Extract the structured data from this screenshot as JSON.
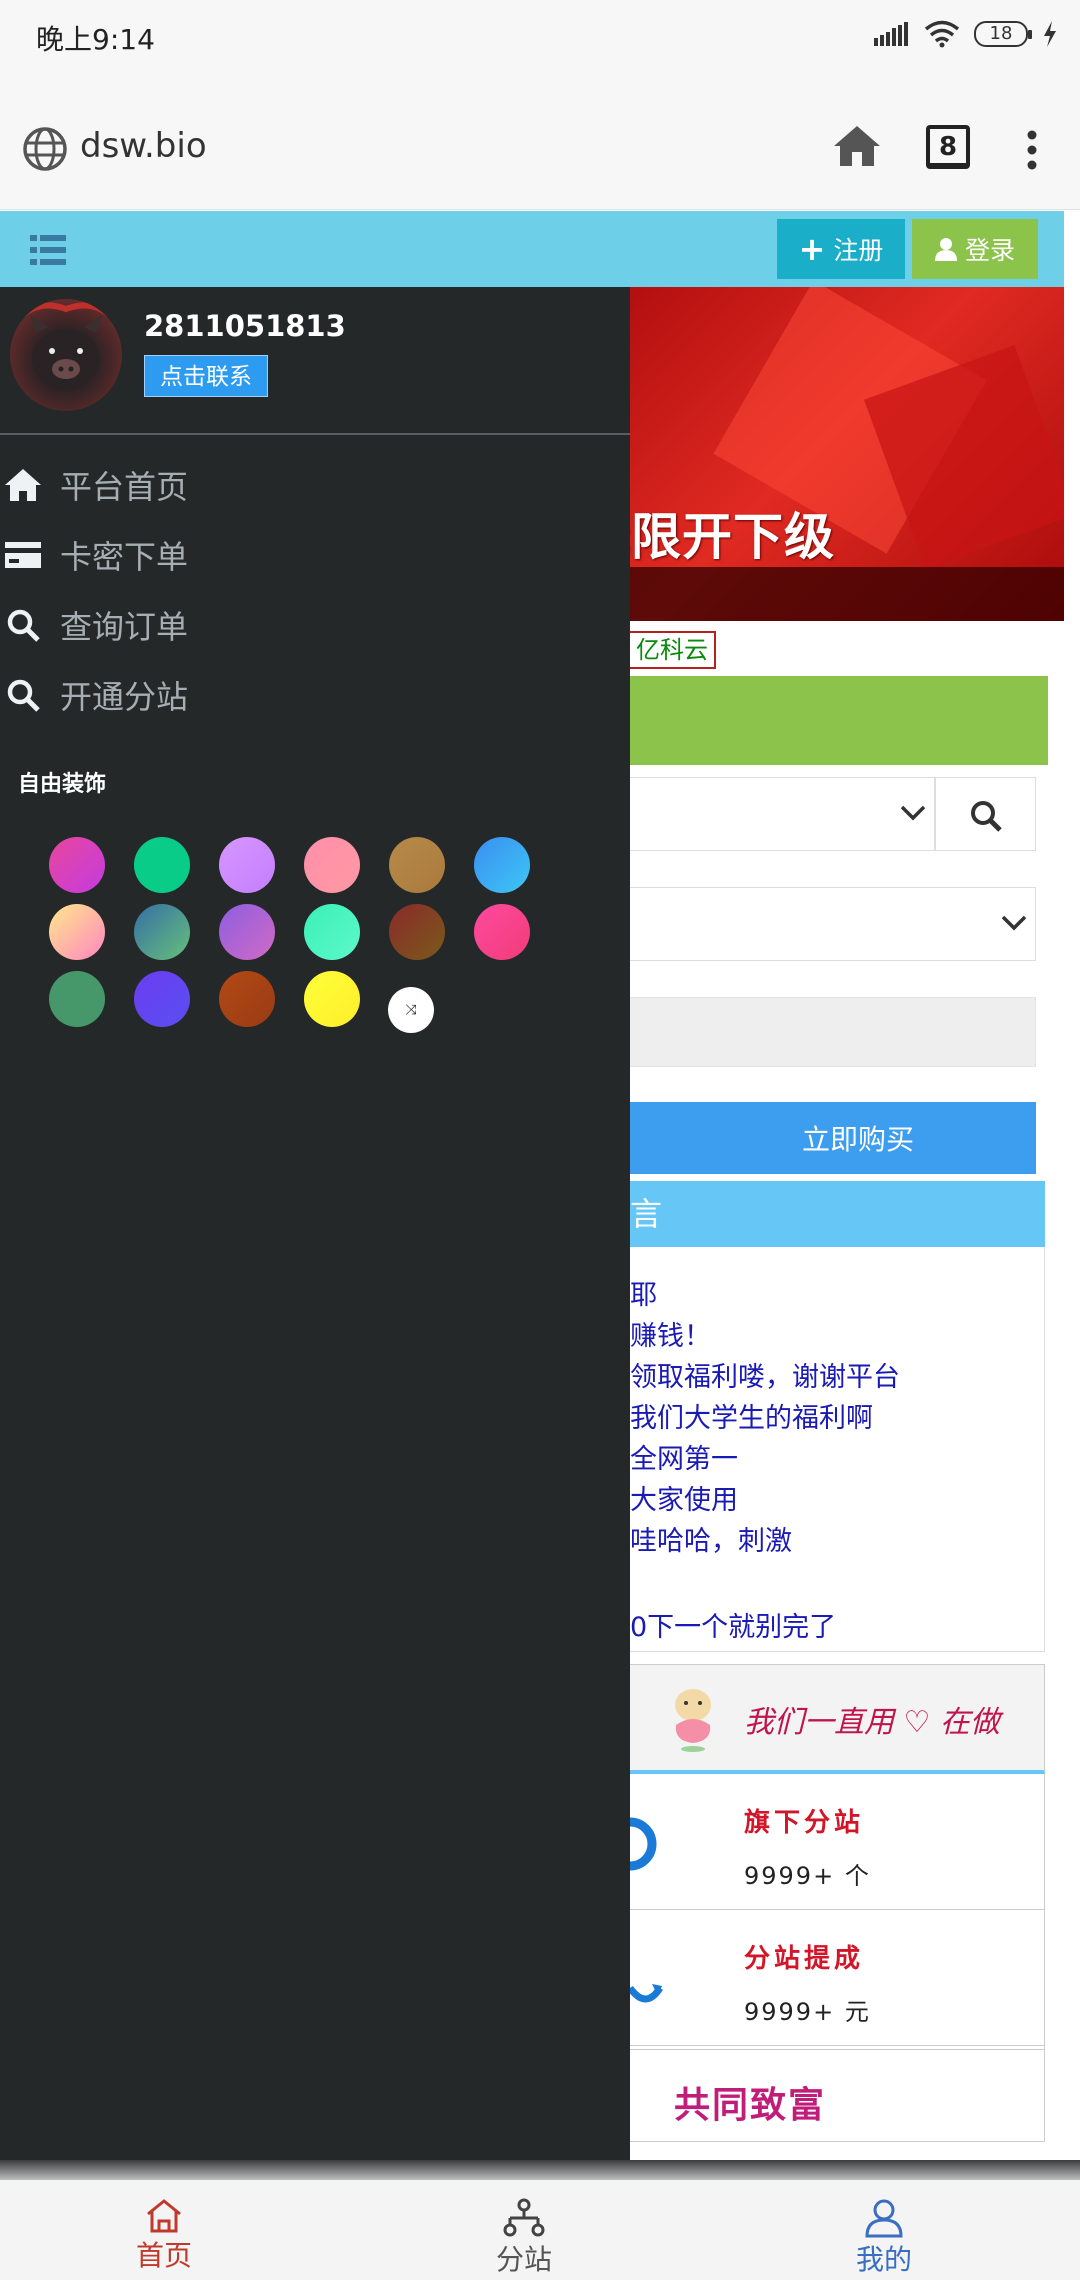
{
  "status_bar": {
    "time": "晚上9:14",
    "battery": "18"
  },
  "browser": {
    "url": "dsw.bio",
    "tab_count": "8"
  },
  "header": {
    "register_label": "注册",
    "login_label": "登录"
  },
  "drawer": {
    "username": "2811051813",
    "contact_label": "点击联系",
    "nav": [
      {
        "label": "平台首页",
        "icon": "home-icon"
      },
      {
        "label": "卡密下单",
        "icon": "card-icon"
      },
      {
        "label": "查询订单",
        "icon": "search-icon"
      },
      {
        "label": "开通分站",
        "icon": "search-icon"
      }
    ],
    "decor_title": "自由装饰",
    "swatches": [
      [
        "#e8469c",
        "#c43ce0"
      ],
      [
        "#08cc88",
        "#08cc88"
      ],
      [
        "#d696ff",
        "#c47fff"
      ],
      [
        "#ff8fa8",
        "#ff98a6"
      ],
      [
        "#b78a4a",
        "#a97a3c"
      ],
      [
        "#3a8ef0",
        "#3ec6f6"
      ],
      [
        "#ffe88a",
        "#ff86c0"
      ],
      [
        "#366ea6",
        "#66c07a"
      ],
      [
        "#8e5ee0",
        "#d06ac6"
      ],
      [
        "#3af0b4",
        "#5ef8cc"
      ],
      [
        "#8a2a2a",
        "#7a5a1a"
      ],
      [
        "#ff4aa0",
        "#f03c78"
      ],
      [
        "#46986a",
        "#46986a"
      ],
      [
        "#6a3ef0",
        "#5a4ef0"
      ],
      [
        "#b24a14",
        "#9a3a14"
      ],
      [
        "#ffff3a",
        "#ffee2a"
      ]
    ]
  },
  "main": {
    "banner_text": "无限开下级",
    "cloud_tag": "亿科云",
    "buy_label": "立即购买",
    "message_header": "言",
    "messages": [
      "耶",
      "赚钱！",
      "领取福利喽，谢谢平台",
      "我们大学生的福利啊",
      "全网第一",
      "大家使用",
      "哇哈哈，刺激",
      "",
      "0下一个就别完了"
    ],
    "slogan": "我们一直用 ♡ 在做",
    "stats": [
      {
        "title": "旗下分站",
        "value": "9999+ 个"
      },
      {
        "title": "分站提成",
        "value": "9999+ 元"
      }
    ],
    "prosper": "共同致富"
  },
  "bottom_nav": [
    {
      "label": "首页",
      "color": "#c0392b"
    },
    {
      "label": "分站",
      "color": "#555555"
    },
    {
      "label": "我的",
      "color": "#3a6ec0"
    }
  ]
}
